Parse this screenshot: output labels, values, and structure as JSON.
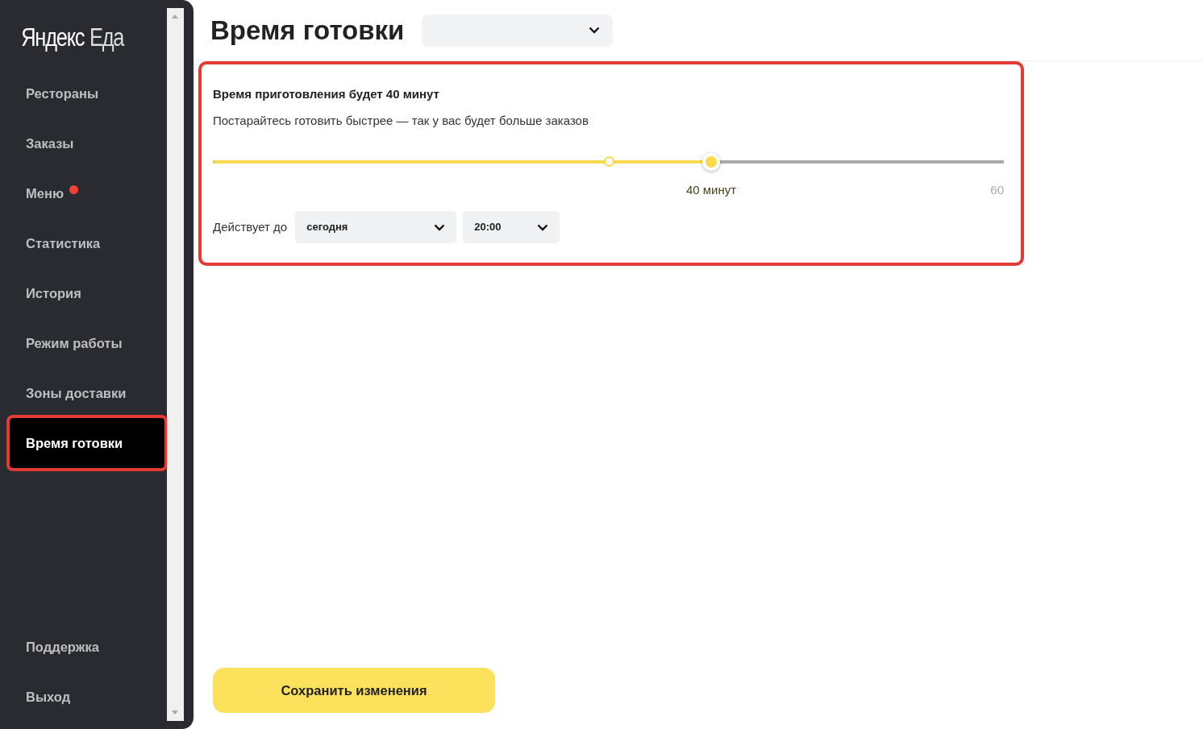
{
  "logo": {
    "brand": "Яндекс",
    "product": "Еда"
  },
  "sidebar": {
    "items": [
      {
        "label": "Рестораны",
        "selected": false,
        "dot": false,
        "highlighted": false
      },
      {
        "label": "Заказы",
        "selected": false,
        "dot": false,
        "highlighted": false
      },
      {
        "label": "Меню",
        "selected": false,
        "dot": true,
        "highlighted": false
      },
      {
        "label": "Статистика",
        "selected": false,
        "dot": false,
        "highlighted": false
      },
      {
        "label": "История",
        "selected": false,
        "dot": false,
        "highlighted": false
      },
      {
        "label": "Режим работы",
        "selected": false,
        "dot": false,
        "highlighted": false
      },
      {
        "label": "Зоны доставки",
        "selected": false,
        "dot": false,
        "highlighted": false
      },
      {
        "label": "Время готовки",
        "selected": true,
        "dot": false,
        "highlighted": true
      }
    ],
    "footer_items": [
      {
        "label": "Поддержка"
      },
      {
        "label": "Выход"
      }
    ]
  },
  "header": {
    "title": "Время готовки",
    "restaurant_select": {
      "expanded": false
    }
  },
  "panel": {
    "highlighted": true,
    "heading": "Время приготовления будет 40 минут",
    "hint": "Постарайтесь готовить быстрее — так у вас будет больше заказов",
    "slider": {
      "level": 0.63,
      "marker": {
        "level": 0.5
      },
      "value_label": "40 минут",
      "max_label": "60"
    },
    "valid_until": {
      "label": "Действует до",
      "day": "сегодня",
      "time": "20:00"
    }
  },
  "save_button": "Сохранить изменения"
}
